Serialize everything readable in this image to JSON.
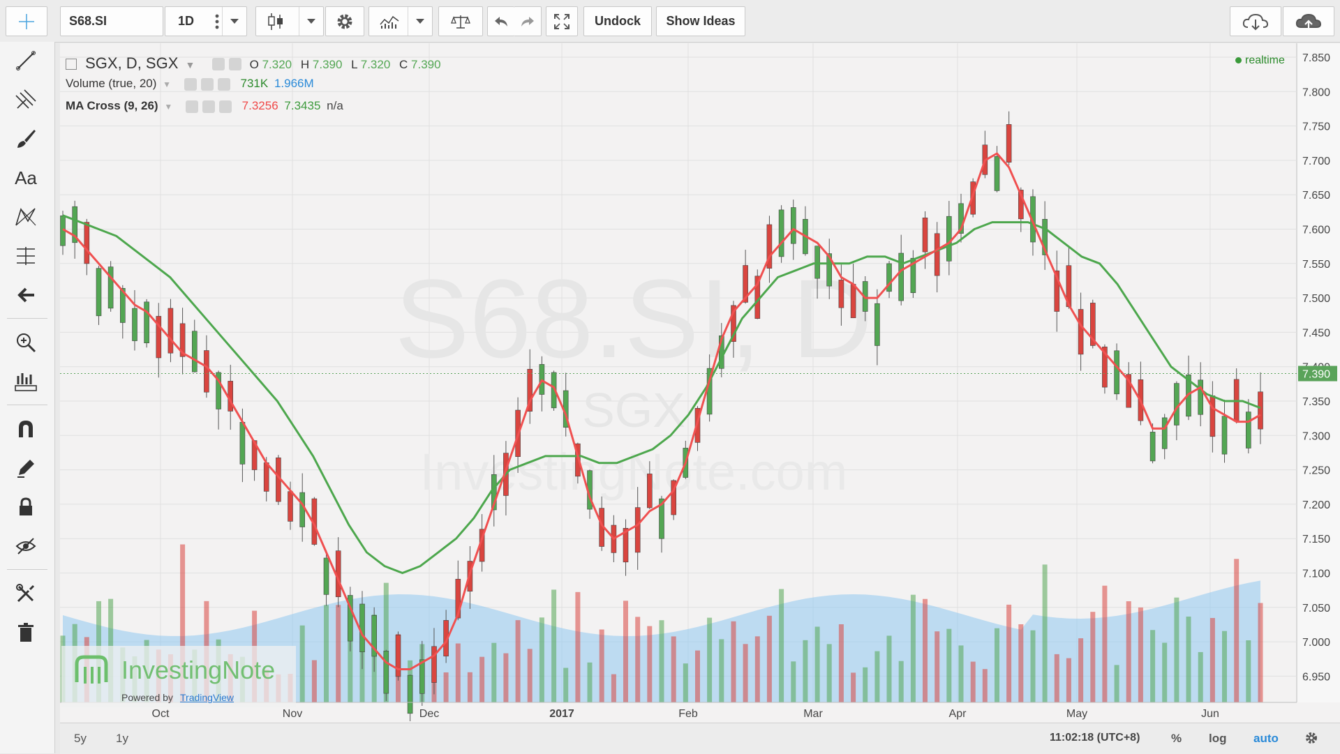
{
  "toolbar": {
    "symbol": "S68.SI",
    "interval": "1D",
    "undock": "Undock",
    "show_ideas": "Show Ideas"
  },
  "legend": {
    "main_title": "SGX, D, SGX",
    "o_label": "O",
    "o_value": "7.320",
    "h_label": "H",
    "h_value": "7.390",
    "l_label": "L",
    "l_value": "7.320",
    "c_label": "C",
    "c_value": "7.390",
    "volume_title": "Volume (true, 20)",
    "volume_value": "731K",
    "volume_ma_value": "1.966M",
    "ma_title": "MA Cross (9, 26)",
    "ma_fast_value": "7.3256",
    "ma_slow_value": "7.3435",
    "ma_extra": "n/a",
    "realtime": "realtime"
  },
  "watermark": {
    "big": "S68.SI, D",
    "exchange": "SGX",
    "site": "InvestingNote.com",
    "logo_text": "InvestingNote",
    "powered_by": "Powered by",
    "powered_link": "TradingView"
  },
  "bottom": {
    "range_5y": "5y",
    "range_1y": "1y",
    "clock": "11:02:18 (UTC+8)",
    "percent": "%",
    "log": "log",
    "auto": "auto"
  },
  "colors": {
    "up": "#53a653",
    "down": "#d9453f",
    "ma_fast": "#f05050",
    "ma_slow": "#4da74d",
    "volume_ma_area": "#8fc8f0",
    "last_price_badge": "#5aa35a"
  },
  "chart_data": {
    "type": "candlestick",
    "symbol": "S68.SI",
    "interval": "D",
    "ylim": [
      6.9,
      7.87
    ],
    "y_ticks": [
      "7.850",
      "7.800",
      "7.750",
      "7.700",
      "7.650",
      "7.600",
      "7.550",
      "7.500",
      "7.450",
      "7.400",
      "7.350",
      "7.300",
      "7.250",
      "7.200",
      "7.150",
      "7.100",
      "7.050",
      "7.000",
      "6.950"
    ],
    "x_ticks": [
      "Oct",
      "Nov",
      "Dec",
      "2017",
      "Feb",
      "Mar",
      "Apr",
      "May",
      "Jun"
    ],
    "last_price": "7.390",
    "series": [
      {
        "name": "MA Cross (9, 26) fast",
        "values": [
          7.6,
          7.59,
          7.57,
          7.55,
          7.53,
          7.51,
          7.49,
          7.48,
          7.46,
          7.44,
          7.42,
          7.41,
          7.4,
          7.38,
          7.35,
          7.32,
          7.29,
          7.26,
          7.24,
          7.22,
          7.2,
          7.17,
          7.13,
          7.09,
          7.05,
          7.01,
          6.99,
          6.97,
          6.96,
          6.96,
          6.97,
          6.98,
          7.0,
          7.04,
          7.1,
          7.15,
          7.2,
          7.25,
          7.3,
          7.35,
          7.38,
          7.37,
          7.33,
          7.27,
          7.21,
          7.17,
          7.15,
          7.16,
          7.17,
          7.19,
          7.2,
          7.22,
          7.26,
          7.32,
          7.38,
          7.44,
          7.48,
          7.5,
          7.52,
          7.56,
          7.58,
          7.6,
          7.59,
          7.58,
          7.56,
          7.53,
          7.52,
          7.5,
          7.5,
          7.52,
          7.54,
          7.55,
          7.56,
          7.57,
          7.58,
          7.6,
          7.65,
          7.7,
          7.71,
          7.69,
          7.65,
          7.61,
          7.57,
          7.53,
          7.49,
          7.46,
          7.44,
          7.42,
          7.4,
          7.38,
          7.35,
          7.31,
          7.31,
          7.34,
          7.36,
          7.37,
          7.34,
          7.33,
          7.32,
          7.32,
          7.33
        ]
      },
      {
        "name": "MA Cross (9, 26) slow",
        "values": [
          7.62,
          7.61,
          7.6,
          7.59,
          7.57,
          7.55,
          7.53,
          7.5,
          7.47,
          7.44,
          7.41,
          7.38,
          7.35,
          7.31,
          7.27,
          7.22,
          7.17,
          7.13,
          7.11,
          7.1,
          7.11,
          7.13,
          7.15,
          7.18,
          7.22,
          7.25,
          7.26,
          7.27,
          7.27,
          7.27,
          7.26,
          7.26,
          7.27,
          7.28,
          7.3,
          7.33,
          7.37,
          7.42,
          7.47,
          7.5,
          7.53,
          7.54,
          7.55,
          7.55,
          7.55,
          7.56,
          7.56,
          7.55,
          7.56,
          7.57,
          7.58,
          7.6,
          7.61,
          7.61,
          7.61,
          7.6,
          7.58,
          7.56,
          7.55,
          7.52,
          7.48,
          7.44,
          7.4,
          7.38,
          7.36,
          7.35,
          7.35,
          7.34
        ]
      }
    ],
    "volume": {
      "unit": "shares",
      "last": "731K",
      "ma_last": "1.966M"
    }
  }
}
